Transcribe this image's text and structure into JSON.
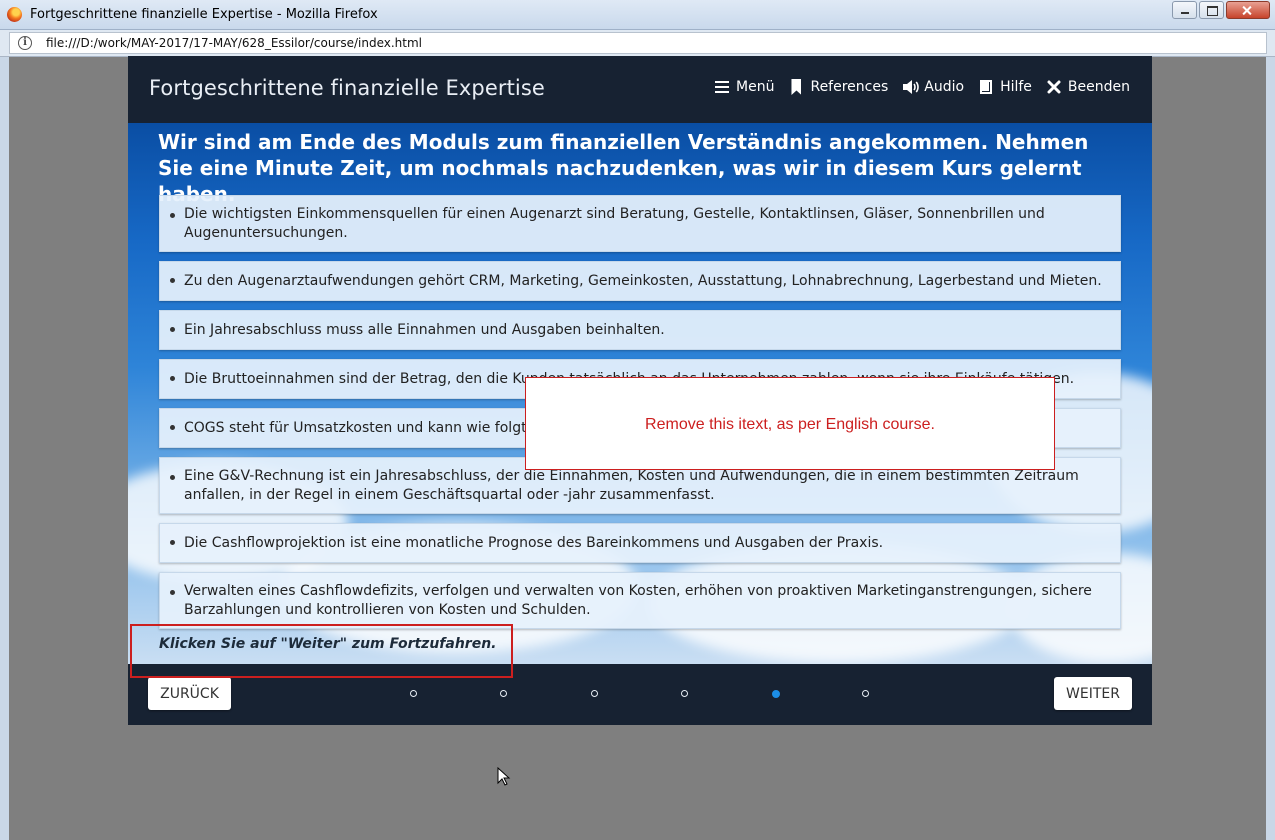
{
  "browser": {
    "window_title": "Fortgeschrittene finanzielle Expertise - Mozilla Firefox",
    "url": "file:///D:/work/MAY-2017/17-MAY/628_Essilor/course/index.html"
  },
  "course": {
    "title": "Fortgeschrittene finanzielle Expertise",
    "nav": [
      {
        "label": "Menü",
        "icon": "menu-icon"
      },
      {
        "label": "References",
        "icon": "bookmark-icon"
      },
      {
        "label": "Audio",
        "icon": "speaker-icon"
      },
      {
        "label": "Hilfe",
        "icon": "help-icon"
      },
      {
        "label": "Beenden",
        "icon": "close-icon"
      }
    ],
    "heading": "Wir sind am Ende des Moduls zum finanziellen Verständnis angekommen. Nehmen Sie eine Minute Zeit, um nochmals nachzudenken, was wir in diesem Kurs gelernt haben.",
    "items": [
      "Die wichtigsten Einkommensquellen für einen Augenarzt sind Beratung, Gestelle, Kontaktlinsen, Gläser, Sonnenbrillen und Augenuntersuchungen.",
      "Zu den Augenarztaufwendungen gehört CRM, Marketing, Gemeinkosten, Ausstattung, Lohnabrechnung, Lagerbestand und Mieten.",
      "Ein Jahresabschluss muss alle Einnahmen und Ausgaben beinhalten.",
      "Die Bruttoeinnahmen sind der Betrag, den die Kunden tatsächlich an das Unternehmen zahlen, wenn sie ihre Einkäufe tätigen.",
      "COGS steht für Umsatzkosten und kann wie folgt berechnet werden: Anfangsbestand + Einkäufe - Endbestand.",
      "Eine G&V-Rechnung ist ein Jahresabschluss, der die Einnahmen, Kosten und Aufwendungen, die in einem bestimmten Zeitraum anfallen, in der Regel in einem Geschäftsquartal oder -jahr zusammenfasst.",
      "Die Cashflowprojektion ist eine monatliche Prognose des Bareinkommens und Ausgaben der Praxis.",
      "Verwalten eines Cashflowdefizits, verfolgen und verwalten von Kosten, erhöhen von proaktiven Marketinganstrengungen, sichere Barzahlungen und kontrollieren von Kosten und Schulden."
    ],
    "prompt": "Klicken Sie auf \"Weiter\" zum Fortzufahren.",
    "back_label": "ZURÜCK",
    "next_label": "WEITER",
    "pagination": {
      "total": 6,
      "current": 5
    }
  },
  "annotation": {
    "note": "Remove this itext, as per English course."
  },
  "colors": {
    "header_bg": "#172232",
    "accent_dot": "#1c8ee6",
    "annotation_red": "#cc1f1f"
  }
}
